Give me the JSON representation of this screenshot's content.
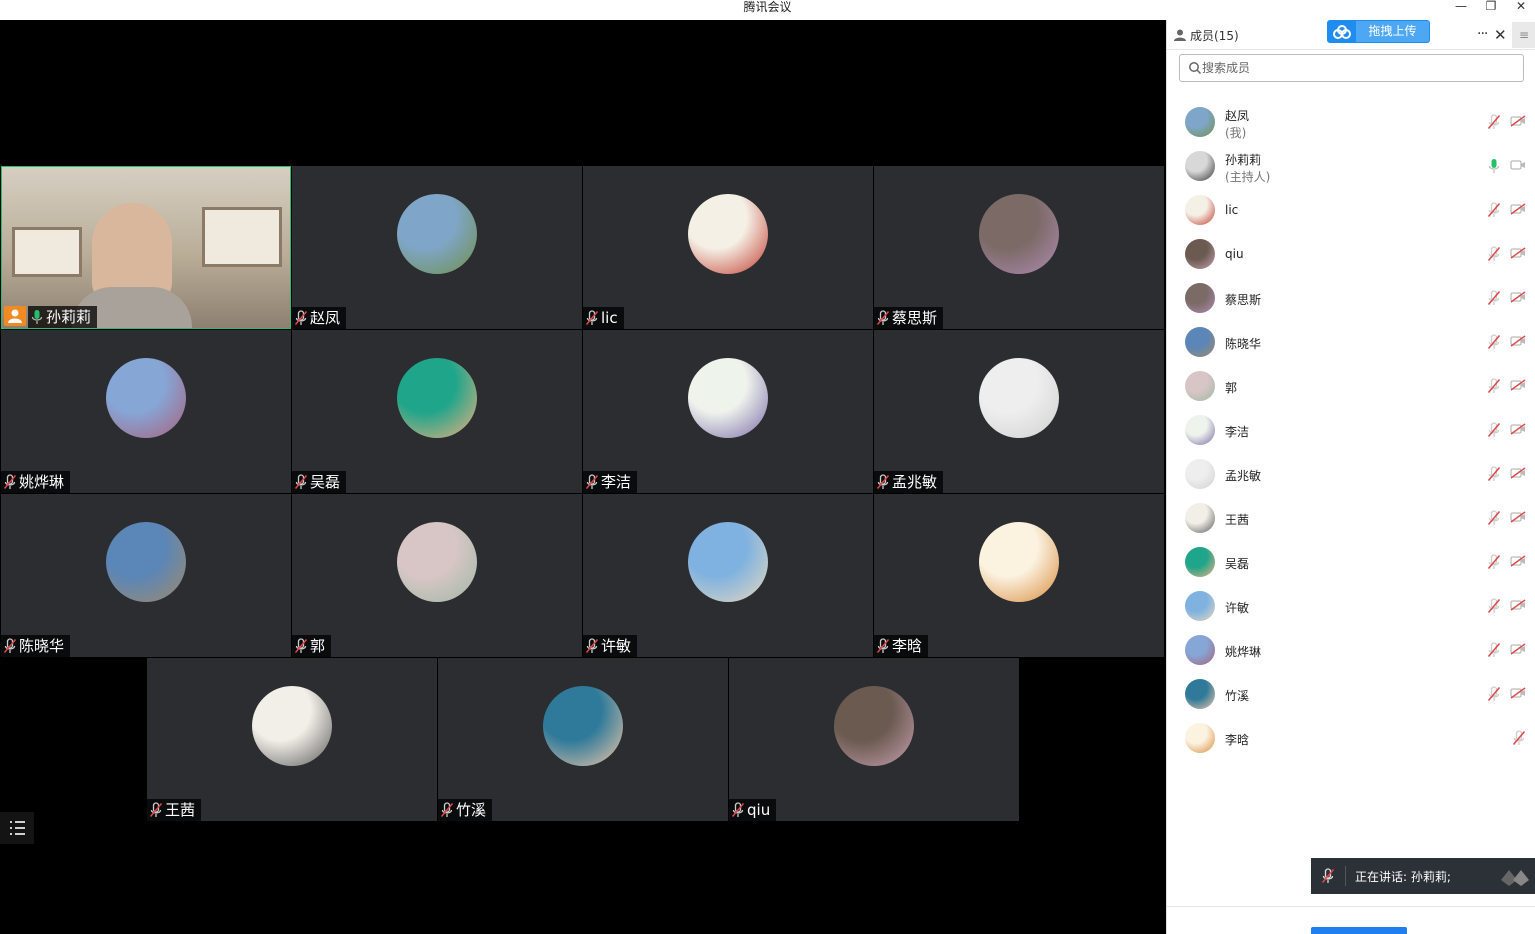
{
  "window": {
    "title": "腾讯会议",
    "minimize": "—",
    "restore": "❐",
    "close": "✕"
  },
  "tiles": [
    {
      "name": "孙莉莉",
      "mic": "on",
      "video": true,
      "host": true,
      "c1": "#c8bca8",
      "c2": "#8a7a66"
    },
    {
      "name": "赵凤",
      "mic": "off",
      "c1": "#7fa6c8",
      "c2": "#6f8f4a"
    },
    {
      "name": "lic",
      "mic": "off",
      "c1": "#f5f0e6",
      "c2": "#c0392b"
    },
    {
      "name": "蔡思斯",
      "mic": "off",
      "c1": "#7b6a66",
      "c2": "#b08bb3"
    },
    {
      "name": "姚烨琳",
      "mic": "off",
      "c1": "#86a6d6",
      "c2": "#a8607a"
    },
    {
      "name": "吴磊",
      "mic": "off",
      "c1": "#1fa58a",
      "c2": "#f0b080"
    },
    {
      "name": "李洁",
      "mic": "off",
      "c1": "#eef3ec",
      "c2": "#7a6aa8"
    },
    {
      "name": "孟兆敏",
      "mic": "off",
      "c1": "#eeeeee",
      "c2": "#d0d0d0"
    },
    {
      "name": "陈晓华",
      "mic": "off",
      "c1": "#5a86b8",
      "c2": "#a08a6a"
    },
    {
      "name": "郭",
      "mic": "off",
      "c1": "#d8c6c6",
      "c2": "#9fb8a4"
    },
    {
      "name": "许敏",
      "mic": "off",
      "c1": "#7fb2e0",
      "c2": "#e8d8c0"
    },
    {
      "name": "李晗",
      "mic": "off",
      "c1": "#fbf2e0",
      "c2": "#d88a3a"
    },
    {
      "name": "王茜",
      "mic": "off",
      "c1": "#f2efe8",
      "c2": "#5a5a5a"
    },
    {
      "name": "竹溪",
      "mic": "off",
      "c1": "#2f7a9a",
      "c2": "#f0c8a8"
    },
    {
      "name": "qiu",
      "mic": "off",
      "c1": "#6a5a50",
      "c2": "#c8a0b0"
    }
  ],
  "side": {
    "title": "成员(15)",
    "upload_label": "拖拽上传",
    "more": "···",
    "close": "✕",
    "menu": "≡",
    "search_placeholder": "搜索成员",
    "members": [
      {
        "name": "赵凤",
        "sub": "(我)",
        "mic": "off",
        "cam": true,
        "c1": "#7fa6c8",
        "c2": "#6f8f4a"
      },
      {
        "name": "孙莉莉",
        "sub": "(主持人)",
        "mic": "on",
        "cam": true,
        "c1": "#d8d8d8",
        "c2": "#333333"
      },
      {
        "name": "lic",
        "mic": "off",
        "cam": true,
        "c1": "#f5f0e6",
        "c2": "#c0392b"
      },
      {
        "name": "qiu",
        "mic": "off",
        "cam": true,
        "c1": "#6a5a50",
        "c2": "#c8a0b0"
      },
      {
        "name": "蔡思斯",
        "mic": "off",
        "cam": true,
        "c1": "#7b6a66",
        "c2": "#b08bb3"
      },
      {
        "name": "陈晓华",
        "mic": "off",
        "cam": true,
        "c1": "#5a86b8",
        "c2": "#a08a6a"
      },
      {
        "name": "郭",
        "mic": "off",
        "cam": true,
        "c1": "#d8c6c6",
        "c2": "#9fb8a4"
      },
      {
        "name": "李洁",
        "mic": "off",
        "cam": true,
        "c1": "#eef3ec",
        "c2": "#7a6aa8"
      },
      {
        "name": "孟兆敏",
        "mic": "off",
        "cam": true,
        "c1": "#eeeeee",
        "c2": "#d0d0d0"
      },
      {
        "name": "王茜",
        "mic": "off",
        "cam": true,
        "c1": "#f2efe8",
        "c2": "#5a5a5a"
      },
      {
        "name": "吴磊",
        "mic": "off",
        "cam": true,
        "c1": "#1fa58a",
        "c2": "#f0b080"
      },
      {
        "name": "许敏",
        "mic": "off",
        "cam": true,
        "c1": "#7fb2e0",
        "c2": "#e8d8c0"
      },
      {
        "name": "姚烨琳",
        "mic": "off",
        "cam": true,
        "c1": "#86a6d6",
        "c2": "#a8607a"
      },
      {
        "name": "竹溪",
        "mic": "off",
        "cam": true,
        "c1": "#2f7a9a",
        "c2": "#f0c8a8"
      },
      {
        "name": "李晗",
        "mic": "off",
        "cam": false,
        "c1": "#fbf2e0",
        "c2": "#d88a3a"
      }
    ],
    "speaking": "正在讲话: 孙莉莉;"
  },
  "colors": {
    "accent": "#1f8cf0",
    "mic_on": "#23c26a",
    "mic_off": "#e0464a",
    "tile_bg": "#2b2d30"
  }
}
